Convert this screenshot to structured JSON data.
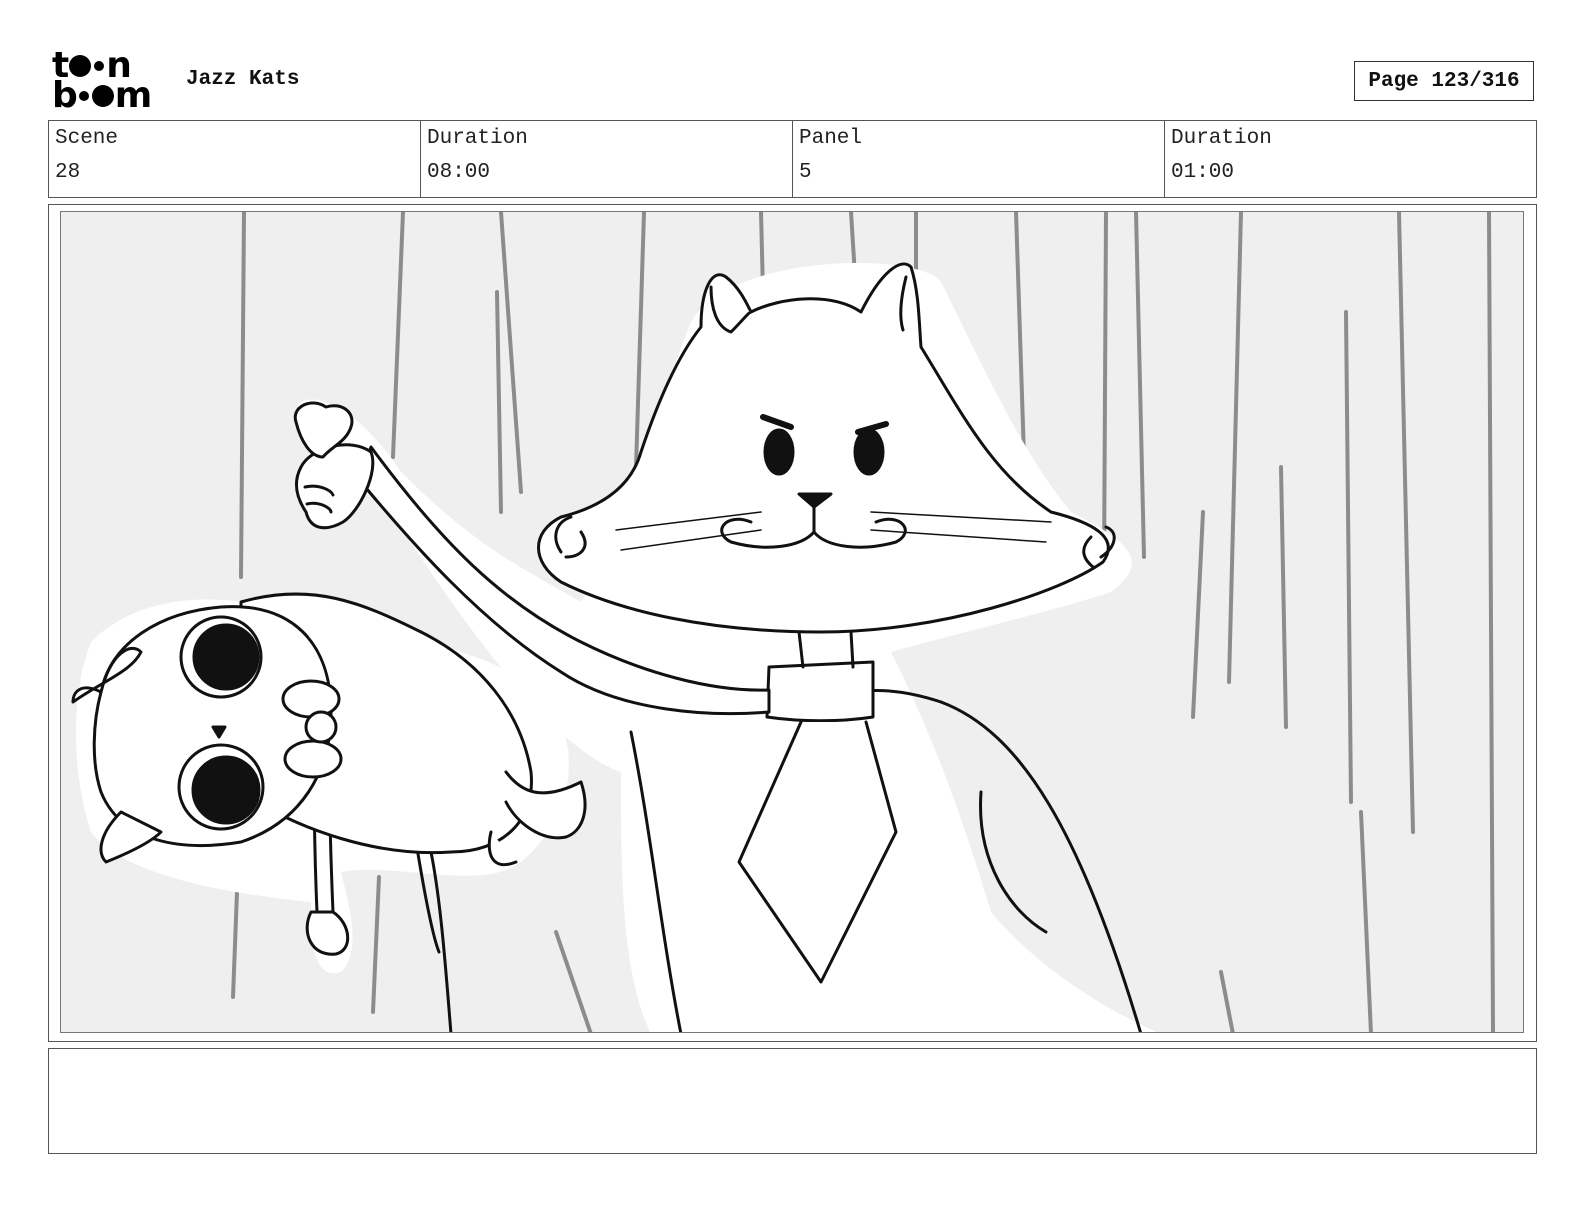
{
  "header": {
    "logo_text": "toon boom",
    "project_title": "Jazz Kats",
    "page_label": "Page 123/316"
  },
  "info": {
    "scene_label": "Scene",
    "scene_value": "28",
    "scene_duration_label": "Duration",
    "scene_duration_value": "08:00",
    "panel_label": "Panel",
    "panel_value": "5",
    "panel_duration_label": "Duration",
    "panel_duration_value": "01:00"
  },
  "notes": {
    "text": ""
  }
}
